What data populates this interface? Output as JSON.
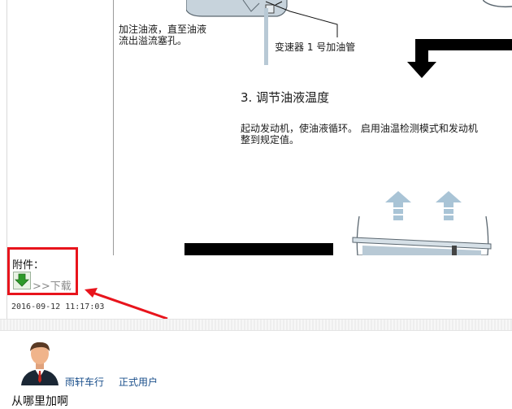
{
  "manual": {
    "left_note_line1": "加注油液，直至油液",
    "left_note_line2": "流出溢流塞孔。",
    "pipe_label": "变速器 1 号加油管",
    "step_heading": "3. 调节油液温度",
    "step_text_line1": "起动发动机，使油液循环。 启用油温检测模式和发动机",
    "step_text_line2": "整到规定值。"
  },
  "attachment": {
    "label": "附件：",
    "download_text": ">>下载",
    "icon": "download-arrow-icon"
  },
  "post": {
    "timestamp": "2016-09-12 11:17:03"
  },
  "reply": {
    "avatar_icon": "male-user-avatar",
    "username": "雨轩车行",
    "role": "正式用户",
    "text": "从哪里加啊"
  },
  "colors": {
    "highlight_box": "#e8141c",
    "annotation_arrow": "#e8141c",
    "link_blue": "#1a4f8b",
    "download_green": "#2e9a2a"
  }
}
